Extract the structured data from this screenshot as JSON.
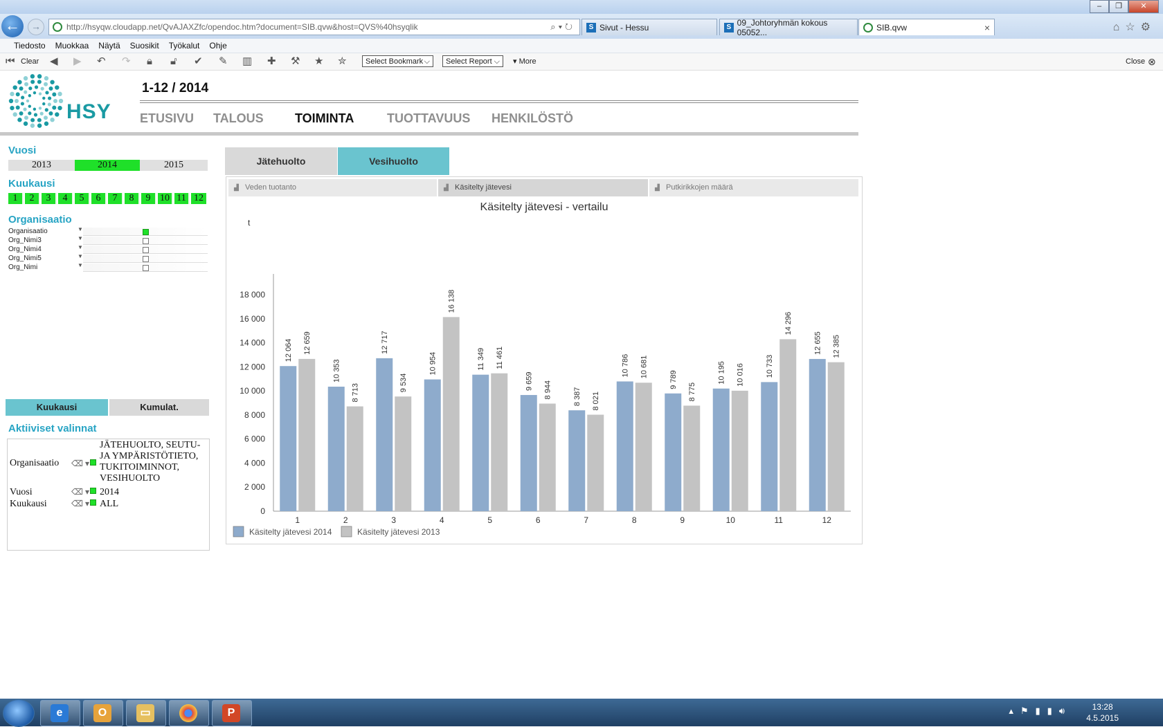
{
  "browser": {
    "address": "http://hsyqw.cloudapp.net/QvAJAXZfc/opendoc.htm?document=SIB.qvw&host=QVS%40hsyqlik",
    "tabs": [
      {
        "label": "Sivut - Hessu",
        "icon": "sharepoint-icon"
      },
      {
        "label": "09_Johtoryhmän kokous 05052...",
        "icon": "sharepoint-icon"
      },
      {
        "label": "SIB.qvw",
        "icon": "qlikview-icon",
        "active": true
      }
    ],
    "tab_close": "×",
    "menu": [
      "Tiedosto",
      "Muokkaa",
      "Näytä",
      "Suosikit",
      "Työkalut",
      "Ohje"
    ]
  },
  "toolbar": {
    "clear": "Clear",
    "bookmark": "Select Bookmark",
    "report": "Select Report",
    "more": "More",
    "close": "Close"
  },
  "header": {
    "logo_text": "HSY",
    "period": "1-12 / 2014",
    "nav": [
      {
        "label": "ETUSIVU"
      },
      {
        "label": "TALOUS"
      },
      {
        "label": "TOIMINTA",
        "active": true
      },
      {
        "label": "TUOTTAVUUS"
      },
      {
        "label": "HENKILÖSTÖ"
      }
    ]
  },
  "filters": {
    "year_title": "Vuosi",
    "years": [
      "2013",
      "2014",
      "2015"
    ],
    "selected_year": "2014",
    "month_title": "Kuukausi",
    "months": [
      "1",
      "2",
      "3",
      "4",
      "5",
      "6",
      "7",
      "8",
      "9",
      "10",
      "11",
      "12"
    ],
    "org_title": "Organisaatio",
    "org_fields": [
      {
        "label": "Organisaatio",
        "selected": true
      },
      {
        "label": "Org_Nimi3",
        "selected": false
      },
      {
        "label": "Org_Nimi4",
        "selected": false
      },
      {
        "label": "Org_Nimi5",
        "selected": false
      },
      {
        "label": "Org_Nimi",
        "selected": false
      }
    ],
    "mode_buttons": [
      "Kuukausi",
      "Kumulat."
    ],
    "active_mode": "Kuukausi"
  },
  "active_selections": {
    "title": "Aktiiviset valinnat",
    "rows": [
      {
        "field": "Organisaatio",
        "value_lines": [
          "JÄTEHUOLTO, SEUTU-",
          "JA YMPÄRISTÖTIETO,",
          "TUKITOIMINNOT,",
          "VESIHUOLTO"
        ]
      },
      {
        "field": "Vuosi",
        "value_lines": [
          "2014"
        ]
      },
      {
        "field": "Kuukausi",
        "value_lines": [
          "ALL"
        ]
      }
    ]
  },
  "main_tabs": [
    {
      "label": "Jätehuolto"
    },
    {
      "label": "Vesihuolto",
      "active": true
    }
  ],
  "sub_tabs": [
    {
      "label": "Veden tuotanto"
    },
    {
      "label": "Käsitelty jätevesi",
      "active": true
    },
    {
      "label": "Putkirikkojen määrä"
    }
  ],
  "colors": {
    "accent": "#27a4c4",
    "selected_green": "#1fe029",
    "tab_active": "#6ac4cf",
    "series_2014": "#8eabcc",
    "series_2013": "#c3c3c3"
  },
  "chart_data": {
    "type": "bar",
    "title": "Käsitelty jätevesi - vertailu",
    "ylabel": "t",
    "xlabel": "",
    "ylim": [
      0,
      18000
    ],
    "yticks": [
      0,
      2000,
      4000,
      6000,
      8000,
      10000,
      12000,
      14000,
      16000,
      18000
    ],
    "ytick_labels": [
      "0",
      "2 000",
      "4 000",
      "6 000",
      "8 000",
      "10 000",
      "12 000",
      "14 000",
      "16 000",
      "18 000"
    ],
    "categories": [
      "1",
      "2",
      "3",
      "4",
      "5",
      "6",
      "7",
      "8",
      "9",
      "10",
      "11",
      "12"
    ],
    "legend_position": "bottom-left",
    "series": [
      {
        "name": "Käsitelty jätevesi 2014",
        "color": "#8eabcc",
        "values": [
          12064,
          10353,
          12717,
          10954,
          11349,
          9659,
          8387,
          10786,
          9789,
          10195,
          10733,
          12655
        ],
        "labels": [
          "12 064",
          "10 353",
          "12 717",
          "10 954",
          "11 349",
          "9 659",
          "8 387",
          "10 786",
          "9 789",
          "10 195",
          "10 733",
          "12 655"
        ]
      },
      {
        "name": "Käsitelty jätevesi 2013",
        "color": "#c3c3c3",
        "values": [
          12659,
          8713,
          9534,
          16138,
          11461,
          8944,
          8021,
          10681,
          8775,
          10016,
          14296,
          12385
        ],
        "labels": [
          "12 659",
          "8 713",
          "9 534",
          "16 138",
          "11 461",
          "8 944",
          "8 021",
          "10 681",
          "8 775",
          "10 016",
          "14 296",
          "12 385"
        ]
      }
    ]
  },
  "taskbar": {
    "time": "13:28",
    "date": "4.5.2015"
  }
}
